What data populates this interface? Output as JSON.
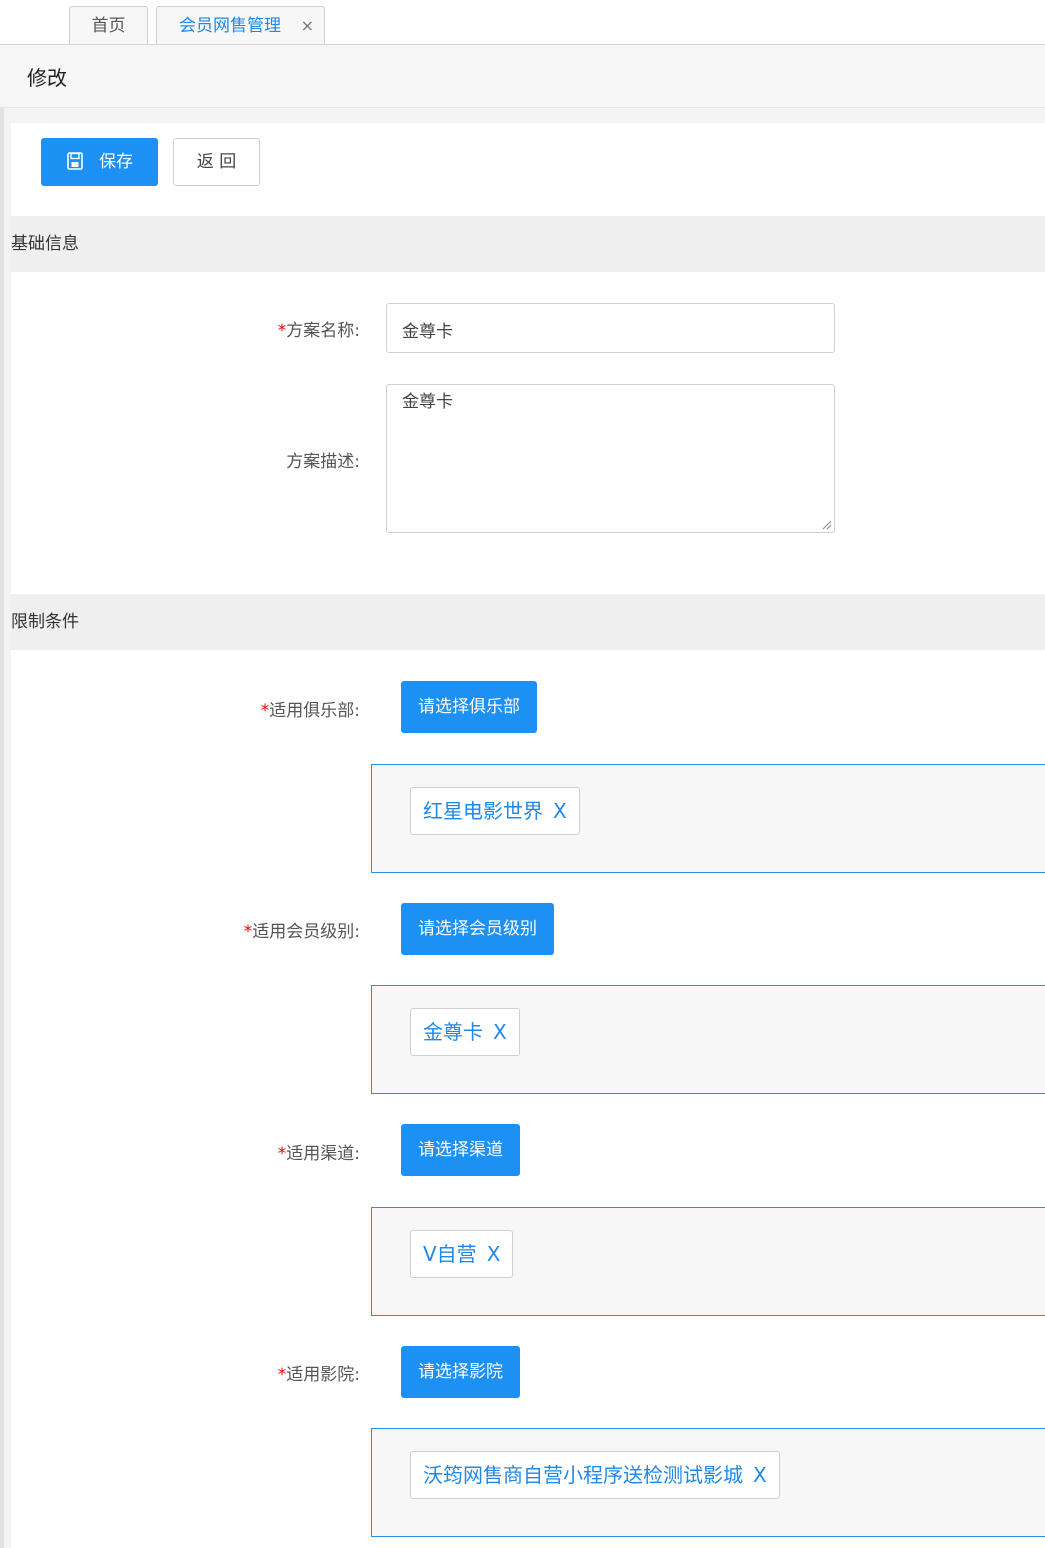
{
  "tabs": [
    {
      "label": "首页"
    },
    {
      "label": "会员网售管理",
      "close": "×"
    }
  ],
  "page": {
    "title": "修改"
  },
  "toolbar": {
    "save_label": "保存",
    "back_label": "返 回",
    "save_icon": "floppy-disk-icon"
  },
  "basic": {
    "section_title": "基础信息",
    "name_label": "方案名称:",
    "name_value": "金尊卡",
    "desc_label": "方案描述:",
    "desc_value": "金尊卡"
  },
  "limits": {
    "section_title": "限制条件",
    "club": {
      "label": "适用俱乐部:",
      "button": "请选择俱乐部",
      "tag": "红星电影世界"
    },
    "level": {
      "label": "适用会员级别:",
      "button": "请选择会员级别",
      "tag": "金尊卡"
    },
    "channel": {
      "label": "适用渠道:",
      "button": "请选择渠道",
      "tag": "V自营"
    },
    "cinema": {
      "label": "适用影院:",
      "button": "请选择影院",
      "tag": "沃筠网售商自营小程序送检测试影城"
    }
  },
  "required_mark": "*",
  "tag_remove": "X",
  "colors": {
    "primary": "#1c90f3",
    "required": "#e00000",
    "tag_text": "#1e89e8"
  }
}
